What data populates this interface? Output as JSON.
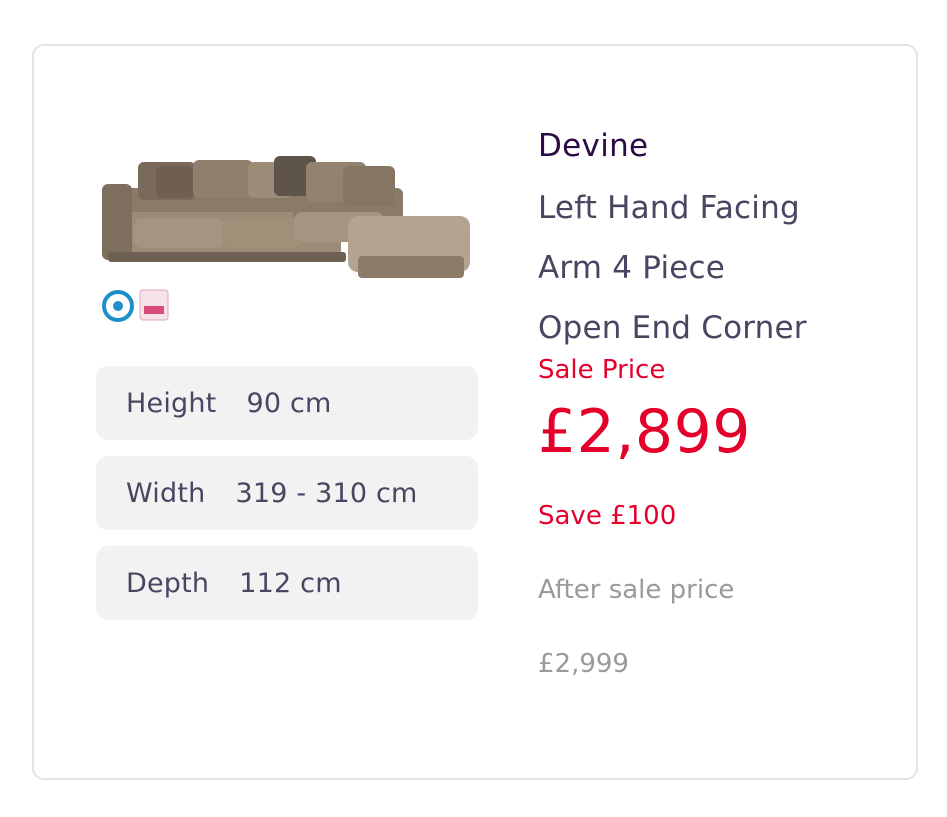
{
  "product": {
    "brand": "Devine",
    "title_lines": [
      "Left Hand Facing",
      "Arm 4 Piece",
      "Open End Corner"
    ],
    "image_icon": "corner-sofa-image",
    "badges": [
      "guarantee-badge",
      "award-badge"
    ]
  },
  "dimensions": [
    {
      "label": "Height",
      "value": "90 cm"
    },
    {
      "label": "Width",
      "value": "319 - 310 cm"
    },
    {
      "label": "Depth",
      "value": "112 cm"
    }
  ],
  "pricing": {
    "sale_label": "Sale Price",
    "sale_price": "£2,899",
    "save_text": "Save £100",
    "after_label": "After sale price",
    "after_price": "£2,999"
  },
  "colors": {
    "accent_red": "#e4002b",
    "brand_purple": "#2b0a45",
    "text_dark": "#4a4560",
    "muted": "#9a9a9a",
    "pill_bg": "#f2f2f2",
    "border": "#e3e3e3"
  }
}
